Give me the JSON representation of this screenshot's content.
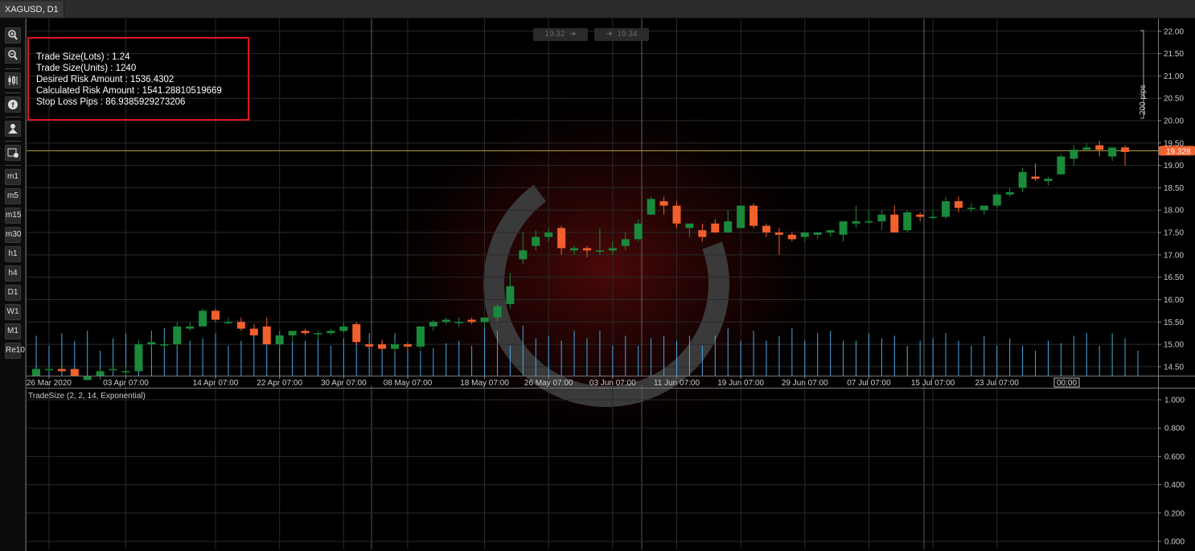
{
  "tab": {
    "title": "XAGUSD, D1"
  },
  "toolbar": {
    "timeframes": [
      "m1",
      "m5",
      "m15",
      "m30",
      "h1",
      "h4",
      "D1",
      "W1",
      "M1",
      "Re10"
    ]
  },
  "info": {
    "lines": [
      "Trade Size(Lots) : 1.24",
      "Trade Size(Units) : 1240",
      "Desired Risk Amount : 1536.4302",
      "Calculated Risk Amount : 1541.28810519669",
      "Stop Loss Pips : 86.9385929273206"
    ]
  },
  "nav": {
    "left_price": "19.32",
    "right_price": "19.34"
  },
  "colors": {
    "up": "#1a8a3c",
    "down": "#f2602c",
    "volume": "#4aa8e0",
    "price_line": "#bba442",
    "grid": "#2a2a2a"
  },
  "chart_data": [
    {
      "type": "candlestick",
      "symbol": "XAGUSD",
      "timeframe": "D1",
      "current_price": "19.328",
      "scale_label": "200 pips",
      "y_ticks": [
        "14.50",
        "15.00",
        "15.50",
        "16.00",
        "16.50",
        "17.00",
        "17.50",
        "18.00",
        "18.50",
        "19.00",
        "19.50",
        "20.00",
        "20.50",
        "21.00",
        "21.50",
        "22.00"
      ],
      "ylim": [
        14.3,
        22.05
      ],
      "x_labels": [
        "26 Mar 2020",
        "03 Apr 07:00",
        "14 Apr 07:00",
        "22 Apr 07:00",
        "30 Apr 07:00",
        "08 May 07:00",
        "18 May 07:00",
        "26 May 07:00",
        "03 Jun 07:00",
        "11 Jun 07:00",
        "19 Jun 07:00",
        "29 Jun 07:00",
        "07 Jul 07:00",
        "15 Jul 07:00",
        "23 Jul 07:00"
      ],
      "x_label_index": [
        1,
        7,
        14,
        19,
        24,
        29,
        35,
        40,
        45,
        50,
        55,
        60,
        65,
        70,
        75
      ],
      "cursor_label": "00:00",
      "ohlc": [
        [
          14.3,
          14.45,
          14.3,
          14.45
        ],
        [
          14.45,
          14.5,
          14.4,
          14.45
        ],
        [
          14.45,
          14.5,
          14.4,
          14.4
        ],
        [
          14.45,
          14.45,
          14.3,
          14.3
        ],
        [
          14.2,
          14.3,
          14.2,
          14.3
        ],
        [
          14.3,
          14.45,
          14.2,
          14.4
        ],
        [
          14.45,
          14.5,
          14.4,
          14.45
        ],
        [
          14.4,
          14.5,
          14.3,
          14.4
        ],
        [
          14.4,
          15.1,
          14.4,
          15.0
        ],
        [
          15.0,
          15.1,
          14.95,
          15.05
        ],
        [
          15.0,
          15.1,
          14.9,
          15.0
        ],
        [
          15.0,
          15.5,
          14.95,
          15.4
        ],
        [
          15.35,
          15.5,
          15.3,
          15.4
        ],
        [
          15.4,
          15.8,
          15.4,
          15.75
        ],
        [
          15.75,
          15.8,
          15.5,
          15.55
        ],
        [
          15.5,
          15.6,
          15.45,
          15.5
        ],
        [
          15.5,
          15.6,
          15.3,
          15.35
        ],
        [
          15.35,
          15.45,
          15.2,
          15.2
        ],
        [
          15.4,
          15.6,
          15.0,
          15.0
        ],
        [
          15.0,
          15.3,
          14.9,
          15.2
        ],
        [
          15.2,
          15.3,
          15.1,
          15.3
        ],
        [
          15.3,
          15.35,
          15.2,
          15.25
        ],
        [
          15.25,
          15.3,
          15.1,
          15.25
        ],
        [
          15.25,
          15.35,
          15.2,
          15.3
        ],
        [
          15.3,
          15.5,
          15.25,
          15.4
        ],
        [
          15.45,
          15.5,
          15.0,
          15.05
        ],
        [
          15.0,
          15.05,
          14.9,
          14.95
        ],
        [
          15.0,
          15.1,
          14.85,
          14.9
        ],
        [
          14.9,
          15.05,
          14.8,
          15.0
        ],
        [
          15.0,
          15.05,
          14.85,
          14.95
        ],
        [
          14.95,
          15.4,
          14.9,
          15.4
        ],
        [
          15.4,
          15.55,
          15.3,
          15.5
        ],
        [
          15.5,
          15.6,
          15.45,
          15.55
        ],
        [
          15.5,
          15.6,
          15.4,
          15.5
        ],
        [
          15.55,
          15.6,
          15.45,
          15.5
        ],
        [
          15.5,
          15.6,
          15.35,
          15.6
        ],
        [
          15.6,
          15.9,
          15.5,
          15.85
        ],
        [
          15.9,
          16.6,
          15.8,
          16.3
        ],
        [
          16.9,
          17.5,
          16.8,
          17.1
        ],
        [
          17.2,
          17.55,
          17.1,
          17.4
        ],
        [
          17.4,
          17.6,
          17.3,
          17.5
        ],
        [
          17.6,
          17.65,
          17.0,
          17.15
        ],
        [
          17.1,
          17.2,
          17.0,
          17.15
        ],
        [
          17.15,
          17.2,
          16.95,
          17.1
        ],
        [
          17.1,
          17.6,
          17.0,
          17.1
        ],
        [
          17.1,
          17.3,
          17.0,
          17.15
        ],
        [
          17.2,
          17.5,
          17.1,
          17.35
        ],
        [
          17.35,
          17.8,
          17.3,
          17.7
        ],
        [
          17.9,
          18.3,
          17.9,
          18.25
        ],
        [
          18.2,
          18.3,
          17.9,
          18.1
        ],
        [
          18.1,
          18.2,
          17.6,
          17.7
        ],
        [
          17.6,
          17.7,
          17.4,
          17.7
        ],
        [
          17.55,
          17.7,
          17.3,
          17.4
        ],
        [
          17.7,
          17.8,
          17.5,
          17.5
        ],
        [
          17.5,
          18.0,
          17.5,
          17.75
        ],
        [
          17.6,
          18.1,
          17.6,
          18.1
        ],
        [
          18.1,
          18.15,
          17.6,
          17.65
        ],
        [
          17.65,
          17.7,
          17.4,
          17.5
        ],
        [
          17.5,
          17.6,
          17.0,
          17.45
        ],
        [
          17.45,
          17.5,
          17.3,
          17.35
        ],
        [
          17.4,
          17.5,
          17.3,
          17.5
        ],
        [
          17.45,
          17.5,
          17.35,
          17.5
        ],
        [
          17.5,
          17.55,
          17.4,
          17.55
        ],
        [
          17.45,
          17.6,
          17.3,
          17.75
        ],
        [
          17.7,
          18.1,
          17.6,
          17.75
        ],
        [
          17.75,
          18.0,
          17.7,
          17.75
        ],
        [
          17.75,
          18.0,
          17.55,
          17.9
        ],
        [
          17.9,
          18.1,
          17.55,
          17.5
        ],
        [
          17.55,
          18.0,
          17.5,
          17.95
        ],
        [
          17.9,
          17.95,
          17.75,
          17.85
        ],
        [
          17.85,
          18.0,
          17.8,
          17.85
        ],
        [
          17.85,
          18.3,
          17.8,
          18.2
        ],
        [
          18.2,
          18.3,
          17.95,
          18.05
        ],
        [
          18.05,
          18.15,
          17.95,
          18.05
        ],
        [
          18.0,
          18.1,
          17.9,
          18.1
        ],
        [
          18.1,
          18.4,
          18.05,
          18.35
        ],
        [
          18.35,
          18.5,
          18.3,
          18.4
        ],
        [
          18.5,
          18.95,
          18.4,
          18.85
        ],
        [
          18.75,
          19.05,
          18.65,
          18.7
        ],
        [
          18.65,
          18.75,
          18.55,
          18.7
        ],
        [
          18.8,
          19.25,
          18.8,
          19.2
        ],
        [
          19.15,
          19.45,
          19.0,
          19.35
        ],
        [
          19.35,
          19.5,
          19.35,
          19.4
        ],
        [
          19.45,
          19.55,
          19.2,
          19.35
        ],
        [
          19.2,
          19.4,
          19.1,
          19.4
        ],
        [
          19.4,
          19.45,
          19.0,
          19.3
        ]
      ],
      "volume_rel": [
        0.8,
        0.6,
        0.85,
        0.7,
        0.9,
        0.5,
        0.75,
        0.85,
        0.6,
        0.9,
        0.95,
        0.6,
        0.7,
        0.75,
        0.85,
        0.6,
        0.7,
        0.95,
        0.8,
        0.9,
        0.7,
        0.7,
        0.8,
        0.6,
        0.75,
        0.8,
        0.85,
        0.7,
        0.85,
        0.6,
        0.5,
        0.55,
        0.65,
        0.7,
        0.6,
        0.95,
        0.9,
        0.6,
        1.0,
        0.75,
        0.8,
        0.7,
        0.9,
        0.75,
        0.9,
        0.6,
        0.8,
        0.6,
        0.75,
        0.8,
        0.7,
        0.8,
        0.6,
        0.8,
        0.95,
        0.7,
        0.9,
        0.7,
        0.8,
        0.95,
        0.7,
        0.85,
        0.9,
        0.7,
        0.7,
        0.85,
        0.75,
        0.8,
        0.6,
        0.7,
        0.75,
        0.85,
        0.7,
        0.6,
        0.8,
        0.6,
        0.75,
        0.6,
        0.5,
        0.7,
        0.65,
        0.8,
        0.85,
        0.6,
        0.85,
        0.75,
        0.5
      ]
    },
    {
      "type": "line",
      "title": "TradeSize (2, 2, 14, Exponential)",
      "y_ticks": [
        "0.000",
        "0.200",
        "0.400",
        "0.600",
        "0.800",
        "1.000"
      ],
      "ylim": [
        0,
        1.0
      ]
    }
  ]
}
